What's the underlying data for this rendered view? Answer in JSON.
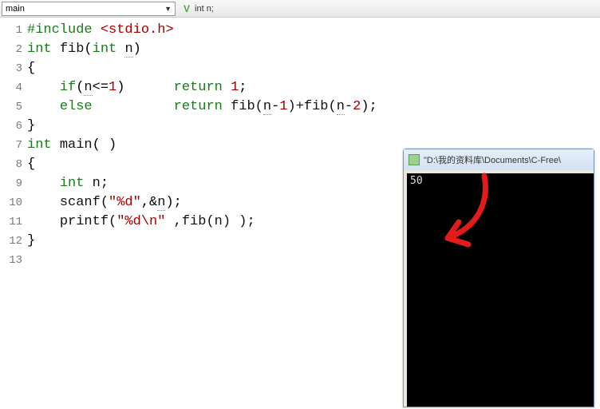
{
  "toolbar": {
    "scope": "main",
    "decl_icon": "V",
    "decl_text": "int n;"
  },
  "gutter": [
    "1",
    "2",
    "3",
    "4",
    "5",
    "6",
    "7",
    "8",
    "9",
    "10",
    "11",
    "12",
    "13"
  ],
  "code": {
    "l1": {
      "pp": "#include",
      "inc": "<stdio.h>"
    },
    "l2": {
      "kw1": "int",
      "id1": "fib",
      "p1": "(",
      "kw2": "int",
      "sp": " ",
      "var": "n",
      "p2": ")"
    },
    "l3": "{",
    "l4": {
      "indent": "    ",
      "kw": "if",
      "p1": "(",
      "var": "n",
      "op": "<=",
      "num": "1",
      "p2": ")",
      "pad": "      ",
      "ret": "return",
      "sp": " ",
      "val": "1",
      "semi": ";"
    },
    "l5": {
      "indent": "    ",
      "kw": "else",
      "pad": "          ",
      "ret": "return",
      "sp": " ",
      "f1": "fib(",
      "v1": "n",
      "m1": "-",
      "n1": "1",
      "c1": ")+fib(",
      "v2": "n",
      "m2": "-",
      "n2": "2",
      "c2": ");"
    },
    "l6": "}",
    "l7": {
      "kw": "int",
      "sp": " ",
      "id": "main",
      "p": "( )"
    },
    "l8": "{",
    "l9": {
      "indent": "    ",
      "kw": "int",
      "sp": " ",
      "id": "n;"
    },
    "l10": {
      "indent": "    ",
      "id": "scanf(",
      "str": "\"%d\"",
      "rest": ",&",
      "var": "n",
      "end": ");"
    },
    "l11": {
      "indent": "    ",
      "id": "printf(",
      "str": "\"%d\\n\"",
      "rest": " ,fib(n) );"
    },
    "l12": "}"
  },
  "console": {
    "title": "\"D:\\我的资料库\\Documents\\C-Free\\",
    "output": "50"
  }
}
